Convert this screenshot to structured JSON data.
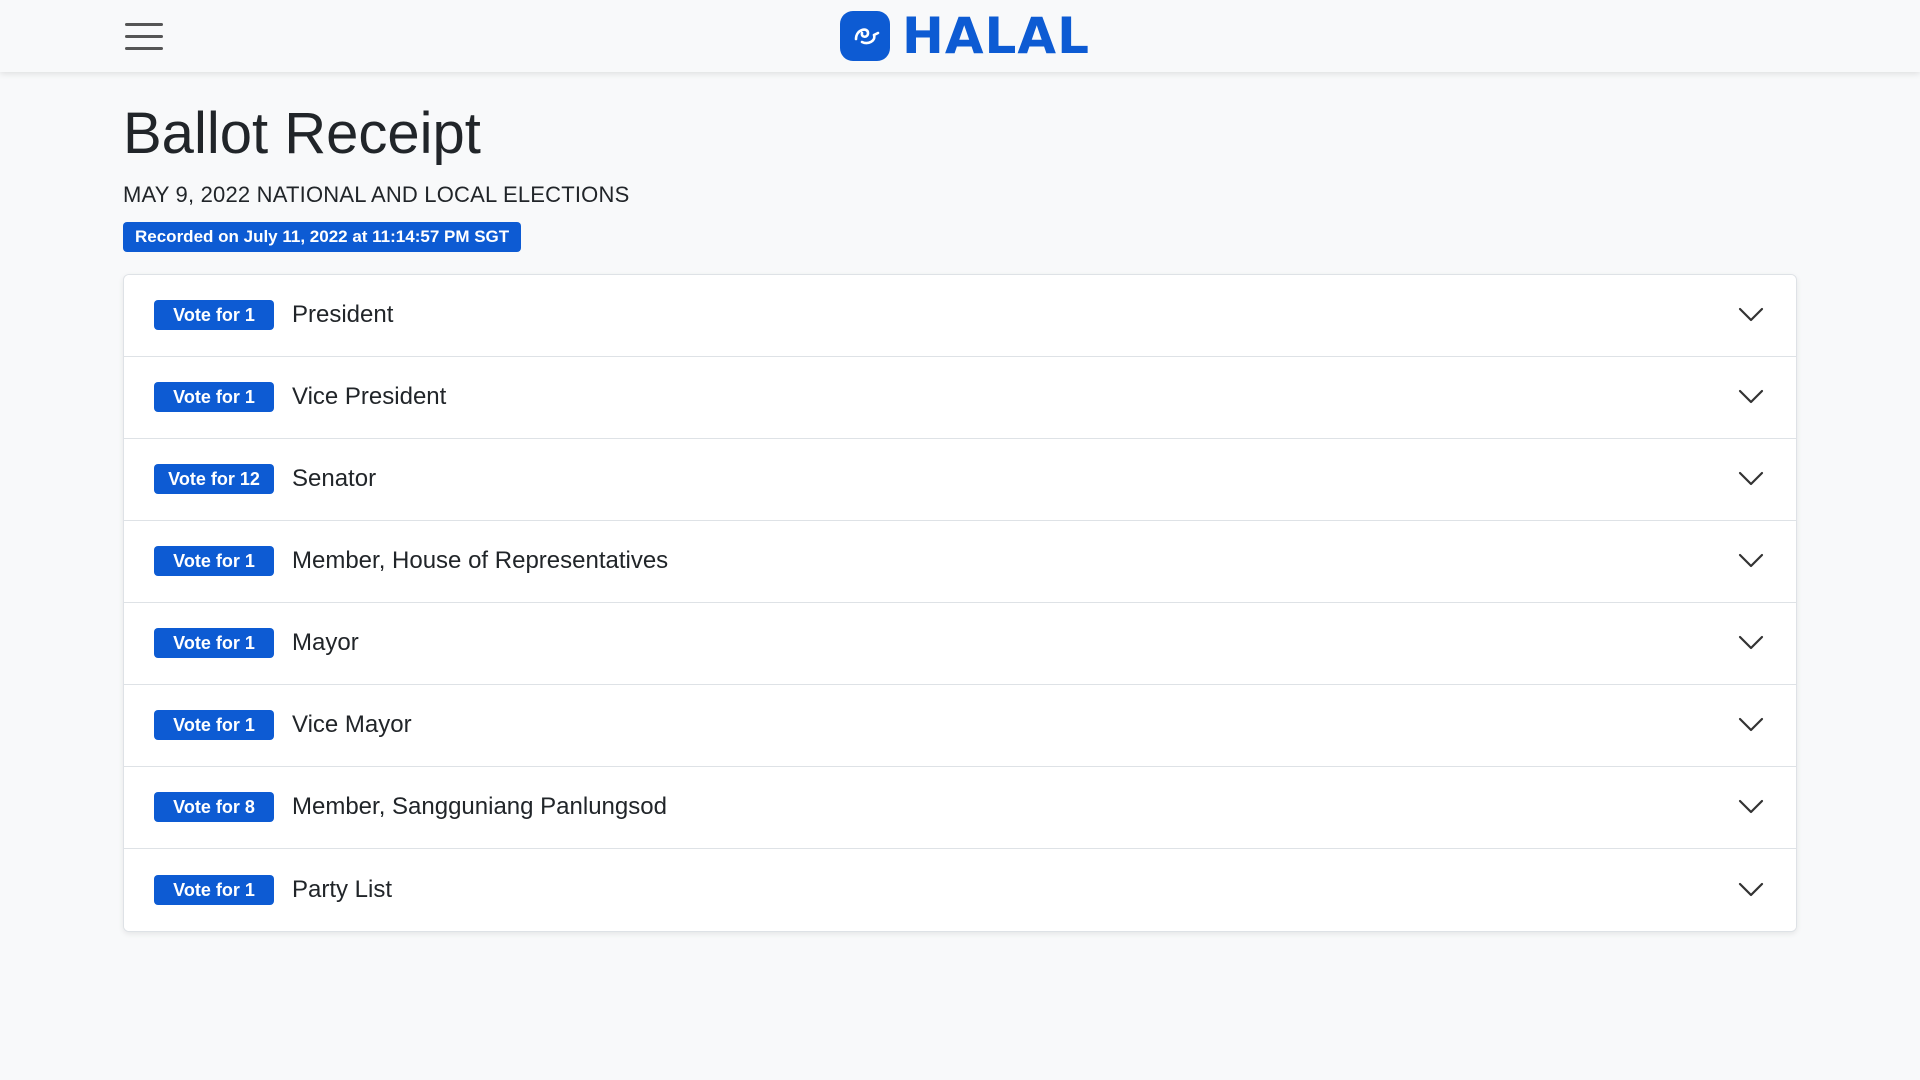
{
  "header": {
    "brand_name": "HALAL",
    "brand_color": "#0d5bd3",
    "menu_icon": "hamburger-icon",
    "logo_icon": "halal-logo-icon"
  },
  "page": {
    "title": "Ballot Receipt",
    "subtitle": "MAY 9, 2022 NATIONAL AND LOCAL ELECTIONS",
    "recorded": "Recorded on July 11, 2022 at 11:14:57 PM SGT"
  },
  "ballot": {
    "chevron_icon": "chevron-down-icon",
    "positions": [
      {
        "vote_label": "Vote for 1",
        "position": "President"
      },
      {
        "vote_label": "Vote for 1",
        "position": "Vice President"
      },
      {
        "vote_label": "Vote for 12",
        "position": "Senator"
      },
      {
        "vote_label": "Vote for 1",
        "position": "Member, House of Representatives"
      },
      {
        "vote_label": "Vote for 1",
        "position": "Mayor"
      },
      {
        "vote_label": "Vote for 1",
        "position": "Vice Mayor"
      },
      {
        "vote_label": "Vote for 8",
        "position": "Member, Sangguniang Panlungsod"
      },
      {
        "vote_label": "Vote for 1",
        "position": "Party List"
      }
    ]
  }
}
